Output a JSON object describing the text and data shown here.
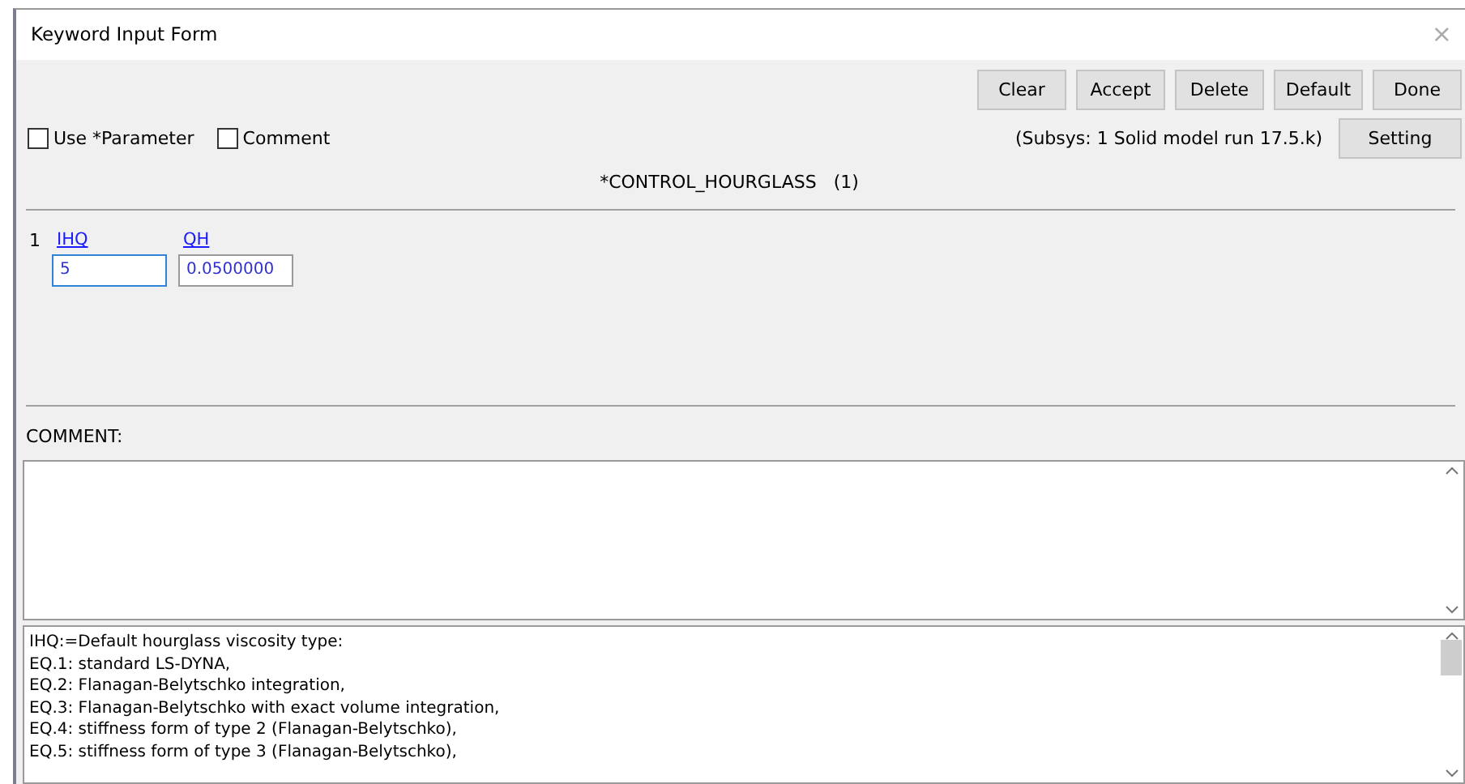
{
  "window": {
    "title": "Keyword Input Form",
    "close": "×"
  },
  "buttons": [
    "Clear",
    "Accept",
    "Delete",
    "Default",
    "Done"
  ],
  "options": [
    {
      "label": "Use *Parameter",
      "checked": false
    },
    {
      "label": "Comment",
      "checked": false
    }
  ],
  "subsys": "(Subsys: 1 Solid model run 17.5.k)",
  "setting_button": "Setting",
  "keyword": "*CONTROL_HOURGLASS   (1)",
  "card": {
    "number": "1",
    "fields": [
      {
        "label": "IHQ",
        "value": "5",
        "focused": true
      },
      {
        "label": "QH",
        "value": "0.0500000",
        "focused": false
      }
    ]
  },
  "comment": {
    "label": "COMMENT:"
  },
  "help": [
    "IHQ:=Default hourglass viscosity type:",
    "EQ.1: standard LS-DYNA,",
    "EQ.2: Flanagan-Belytschko integration,",
    "EQ.3: Flanagan-Belytschko with exact volume integration,",
    "EQ.4: stiffness form of type 2 (Flanagan-Belytschko),",
    "EQ.5: stiffness form of type 3 (Flanagan-Belytschko),"
  ]
}
